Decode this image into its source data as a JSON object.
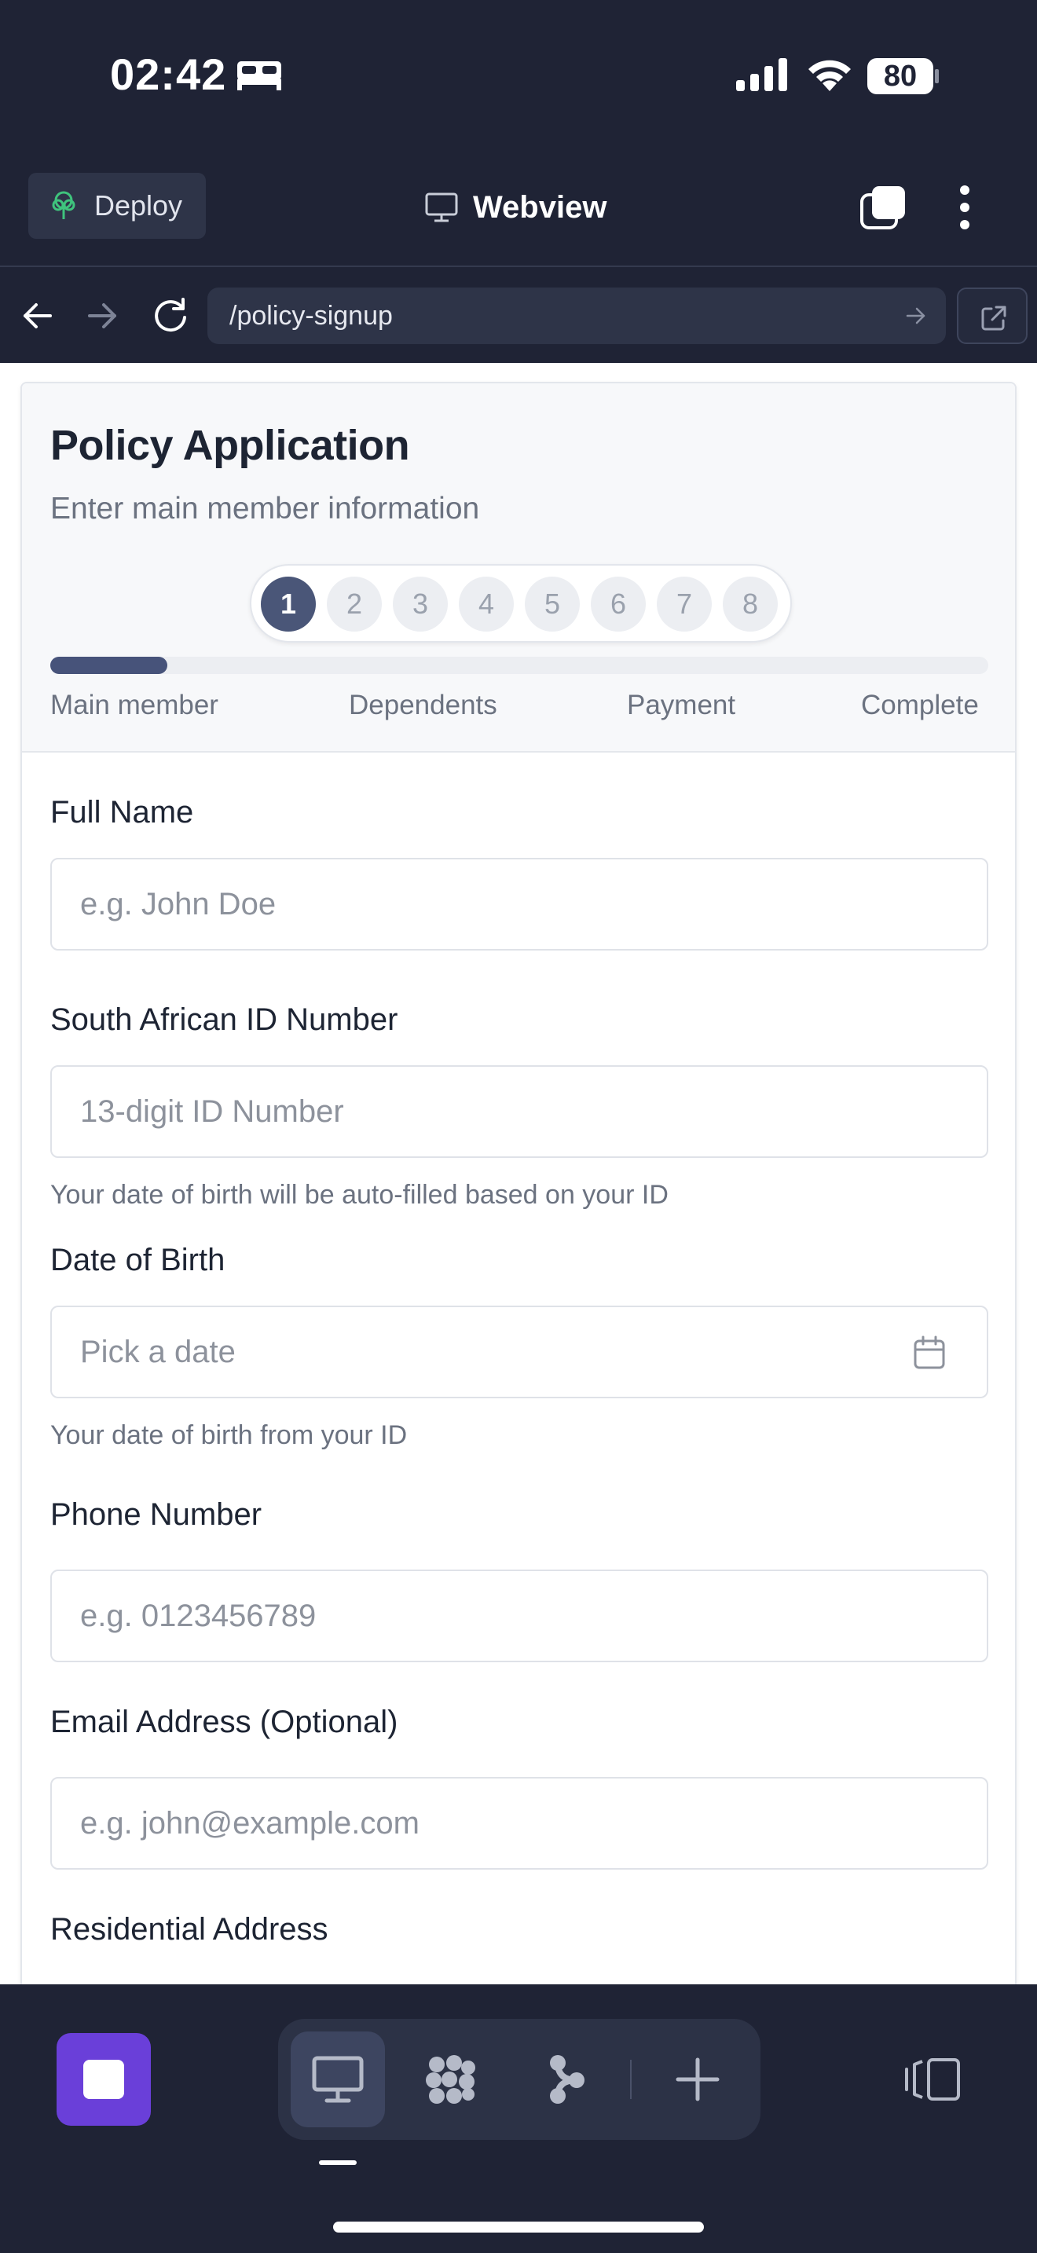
{
  "status_bar": {
    "time": "02:42",
    "battery": "80"
  },
  "webview_header": {
    "deploy_label": "Deploy",
    "title": "Webview"
  },
  "url_bar": {
    "url": "/policy-signup"
  },
  "form_header": {
    "title": "Policy Application",
    "subtitle": "Enter main member information",
    "steps": [
      "1",
      "2",
      "3",
      "4",
      "5",
      "6",
      "7",
      "8"
    ],
    "active_step": 1,
    "progress_fraction": 0.125,
    "stages": [
      "Main member",
      "Dependents",
      "Payment",
      "Complete"
    ]
  },
  "fields": {
    "full_name": {
      "label": "Full Name",
      "placeholder": "e.g. John Doe",
      "value": ""
    },
    "id_number": {
      "label": "South African ID Number",
      "placeholder": "13-digit ID Number",
      "value": "",
      "helper": "Your date of birth will be auto-filled based on your ID"
    },
    "dob": {
      "label": "Date of Birth",
      "placeholder": "Pick a date",
      "helper": "Your date of birth from your ID"
    },
    "phone": {
      "label": "Phone Number",
      "placeholder": "e.g. 0123456789",
      "value": ""
    },
    "email": {
      "label": "Email Address (Optional)",
      "placeholder": "e.g. john@example.com",
      "value": ""
    },
    "address": {
      "label": "Residential Address"
    }
  },
  "icons": {
    "deploy": "tree-icon",
    "webview": "monitor-icon",
    "tabs": "tabs-icon",
    "menu": "more-vertical-icon",
    "back": "arrow-left-icon",
    "forward": "arrow-right-icon",
    "reload": "reload-icon",
    "go": "arrow-right-icon",
    "open_external": "external-link-icon",
    "calendar": "calendar-icon"
  },
  "colors": {
    "chrome_bg": "#1f2335",
    "accent_step": "#4a5678",
    "stop_button": "#6a3fd9"
  }
}
